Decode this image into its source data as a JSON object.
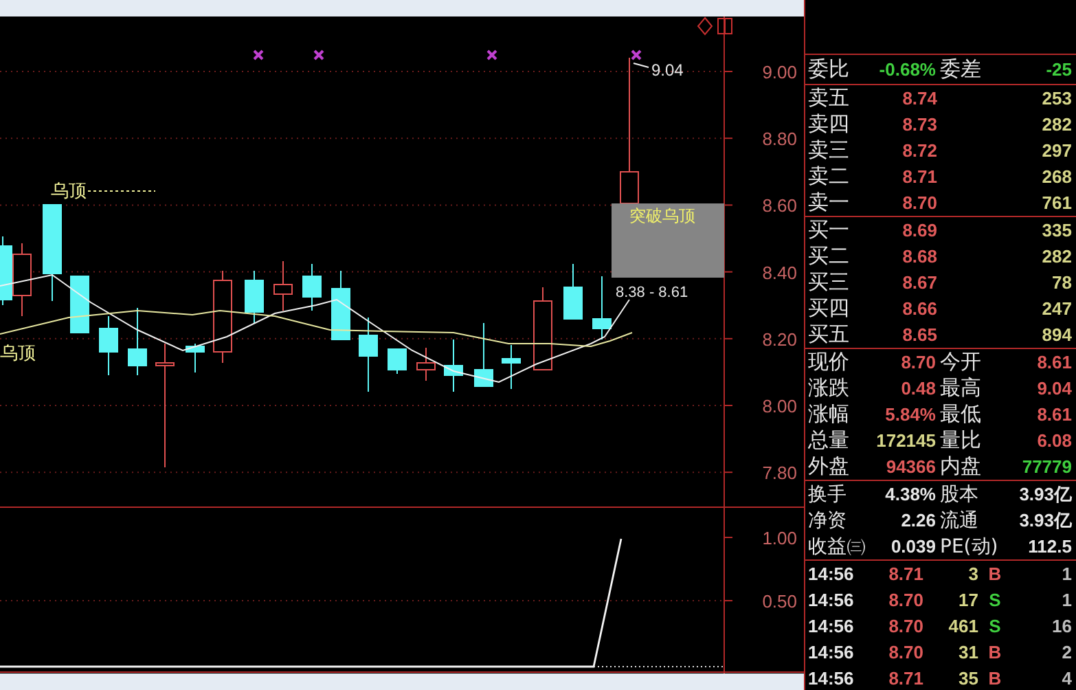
{
  "chart": {
    "corner_icons": [
      {
        "kind": "diamond"
      },
      {
        "kind": "window"
      }
    ],
    "annotations": [
      {
        "kind": "high",
        "text": "9.04"
      },
      {
        "kind": "peak",
        "text": "乌顶"
      },
      {
        "kind": "box",
        "text": "突破乌顶"
      },
      {
        "kind": "range",
        "text": "8.38 - 8.61"
      },
      {
        "kind": "side",
        "text": "乌顶"
      }
    ],
    "price_axis": [
      "9.00",
      "8.80",
      "8.60",
      "8.40",
      "8.20",
      "8.00",
      "7.80"
    ],
    "indicator_axis": [
      "1.00",
      "0.50"
    ]
  },
  "order_book": {
    "ratio": {
      "label": "委比",
      "value": "-0.68%",
      "diff_label": "委差",
      "diff_value": "-25"
    },
    "asks": [
      {
        "label": "卖五",
        "price": "8.74",
        "volume": "253"
      },
      {
        "label": "卖四",
        "price": "8.73",
        "volume": "282"
      },
      {
        "label": "卖三",
        "price": "8.72",
        "volume": "297"
      },
      {
        "label": "卖二",
        "price": "8.71",
        "volume": "268"
      },
      {
        "label": "卖一",
        "price": "8.70",
        "volume": "761"
      }
    ],
    "bids": [
      {
        "label": "买一",
        "price": "8.69",
        "volume": "335"
      },
      {
        "label": "买二",
        "price": "8.68",
        "volume": "282"
      },
      {
        "label": "买三",
        "price": "8.67",
        "volume": "78"
      },
      {
        "label": "买四",
        "price": "8.66",
        "volume": "247"
      },
      {
        "label": "买五",
        "price": "8.65",
        "volume": "894"
      }
    ]
  },
  "quote": [
    {
      "cells": [
        {
          "label": "现价",
          "value": "8.70",
          "color": "#e05a5a"
        },
        {
          "label": "今开",
          "value": "8.61",
          "color": "#e05a5a"
        }
      ]
    },
    {
      "cells": [
        {
          "label": "涨跌",
          "value": "0.48",
          "color": "#e05a5a"
        },
        {
          "label": "最高",
          "value": "9.04",
          "color": "#e05a5a"
        }
      ]
    },
    {
      "cells": [
        {
          "label": "涨幅",
          "value": "5.84%",
          "color": "#e05a5a"
        },
        {
          "label": "最低",
          "value": "8.61",
          "color": "#e05a5a"
        }
      ]
    },
    {
      "cells": [
        {
          "label": "总量",
          "value": "172145",
          "color": "#d6d68a"
        },
        {
          "label": "量比",
          "value": "6.08",
          "color": "#e05a5a"
        }
      ]
    },
    {
      "cells": [
        {
          "label": "外盘",
          "value": "94366",
          "color": "#e05a5a"
        },
        {
          "label": "内盘",
          "value": "77779",
          "color": "#3fcf3f"
        }
      ]
    }
  ],
  "stats": [
    {
      "label": "换手",
      "value": "4.38%",
      "label2": "股本",
      "value2": "3.93亿"
    },
    {
      "label": "净资",
      "value": "2.26",
      "label2": "流通",
      "value2": "3.93亿"
    },
    {
      "label": "收益㈢",
      "value": "0.039",
      "label2": "PE(动)",
      "value2": "112.5"
    }
  ],
  "trades": [
    {
      "time": "14:56",
      "price": "8.71",
      "volume": "3",
      "side": "B",
      "count": "1"
    },
    {
      "time": "14:56",
      "price": "8.70",
      "volume": "17",
      "side": "S",
      "count": "1"
    },
    {
      "time": "14:56",
      "price": "8.70",
      "volume": "461",
      "side": "S",
      "count": "16"
    },
    {
      "time": "14:56",
      "price": "8.70",
      "volume": "31",
      "side": "B",
      "count": "2"
    },
    {
      "time": "14:56",
      "price": "8.71",
      "volume": "35",
      "side": "B",
      "count": "4"
    }
  ]
}
